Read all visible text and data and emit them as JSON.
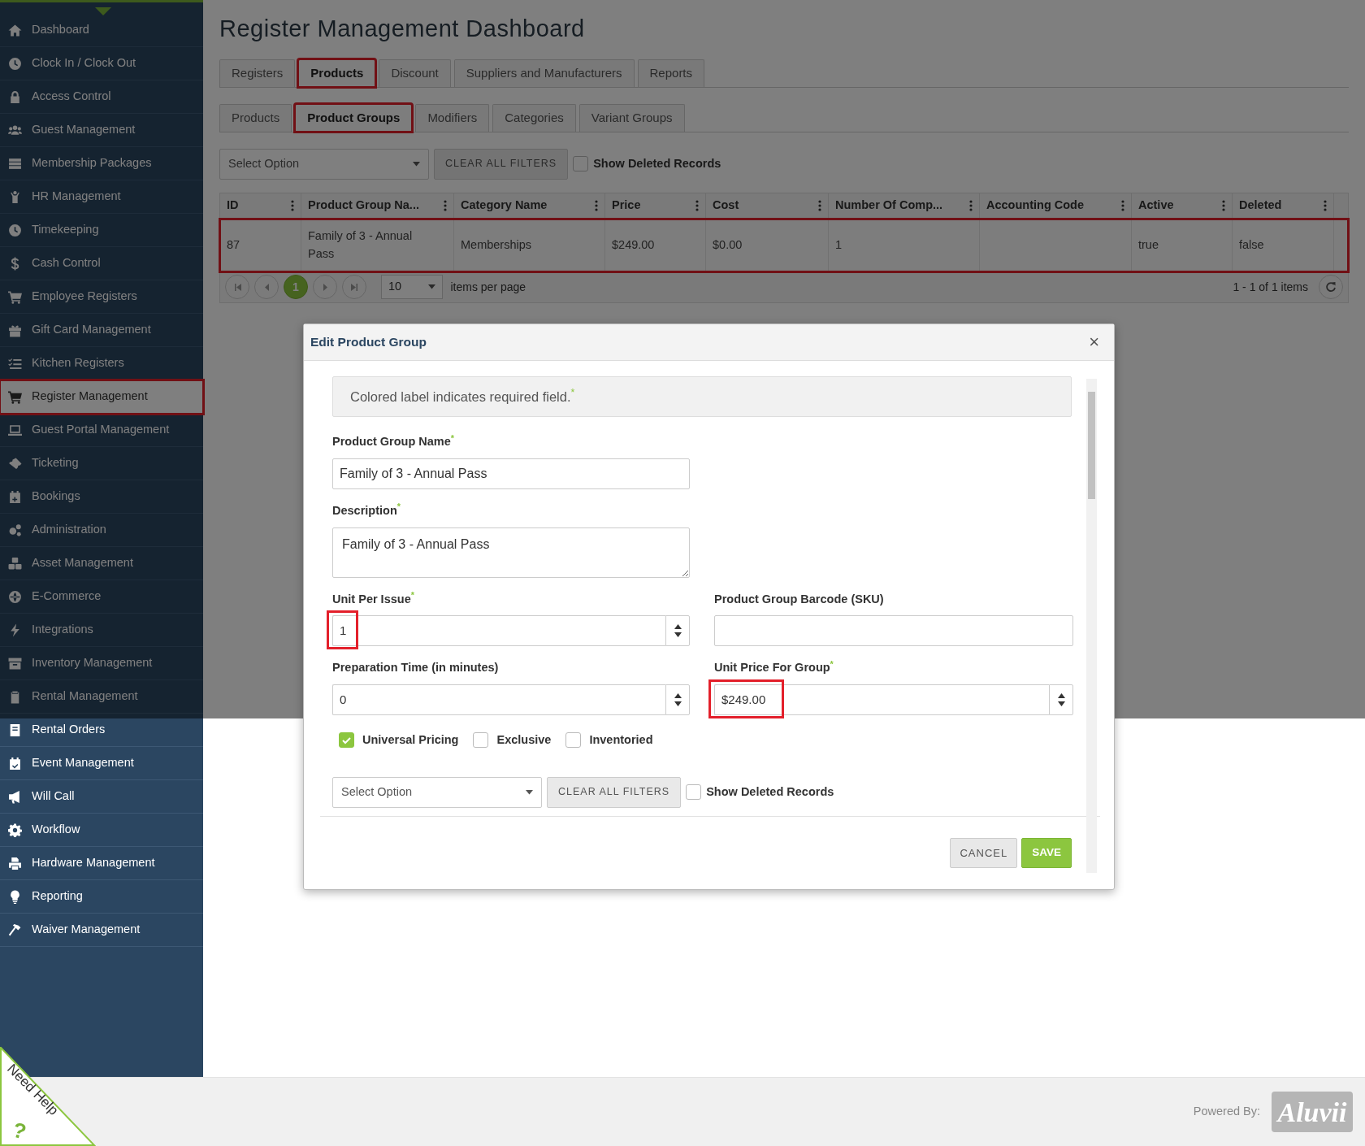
{
  "sidebar": {
    "items": [
      {
        "label": "Dashboard",
        "selected": false,
        "highlighted": false
      },
      {
        "label": "Clock In / Clock Out",
        "selected": false,
        "highlighted": false
      },
      {
        "label": "Access Control",
        "selected": false,
        "highlighted": false
      },
      {
        "label": "Guest Management",
        "selected": false,
        "highlighted": false
      },
      {
        "label": "Membership Packages",
        "selected": false,
        "highlighted": false
      },
      {
        "label": "HR Management",
        "selected": false,
        "highlighted": false
      },
      {
        "label": "Timekeeping",
        "selected": false,
        "highlighted": false
      },
      {
        "label": "Cash Control",
        "selected": false,
        "highlighted": false
      },
      {
        "label": "Employee Registers",
        "selected": false,
        "highlighted": false
      },
      {
        "label": "Gift Card Management",
        "selected": false,
        "highlighted": false
      },
      {
        "label": "Kitchen Registers",
        "selected": false,
        "highlighted": false
      },
      {
        "label": "Register Management",
        "selected": true,
        "highlighted": true
      },
      {
        "label": "Guest Portal Management",
        "selected": false,
        "highlighted": false
      },
      {
        "label": "Ticketing",
        "selected": false,
        "highlighted": false
      },
      {
        "label": "Bookings",
        "selected": false,
        "highlighted": false
      },
      {
        "label": "Administration",
        "selected": false,
        "highlighted": false
      },
      {
        "label": "Asset Management",
        "selected": false,
        "highlighted": false
      },
      {
        "label": "E-Commerce",
        "selected": false,
        "highlighted": false
      },
      {
        "label": "Integrations",
        "selected": false,
        "highlighted": false
      },
      {
        "label": "Inventory Management",
        "selected": false,
        "highlighted": false
      },
      {
        "label": "Rental Management",
        "selected": false,
        "highlighted": false
      },
      {
        "label": "Rental Orders",
        "selected": false,
        "highlighted": false
      },
      {
        "label": "Event Management",
        "selected": false,
        "highlighted": false
      },
      {
        "label": "Will Call",
        "selected": false,
        "highlighted": false
      },
      {
        "label": "Workflow",
        "selected": false,
        "highlighted": false
      },
      {
        "label": "Hardware Management",
        "selected": false,
        "highlighted": false
      },
      {
        "label": "Reporting",
        "selected": false,
        "highlighted": false
      },
      {
        "label": "Waiver Management",
        "selected": false,
        "highlighted": false
      }
    ]
  },
  "page": {
    "title": "Register Management Dashboard"
  },
  "tabs": [
    {
      "label": "Registers",
      "selected": false,
      "highlighted": false
    },
    {
      "label": "Products",
      "selected": true,
      "highlighted": true
    },
    {
      "label": "Discount",
      "selected": false,
      "highlighted": false
    },
    {
      "label": "Suppliers and Manufacturers",
      "selected": false,
      "highlighted": false
    },
    {
      "label": "Reports",
      "selected": false,
      "highlighted": false
    }
  ],
  "subtabs": [
    {
      "label": "Products",
      "selected": false,
      "highlighted": false
    },
    {
      "label": "Product Groups",
      "selected": true,
      "highlighted": true
    },
    {
      "label": "Modifiers",
      "selected": false,
      "highlighted": false
    },
    {
      "label": "Categories",
      "selected": false,
      "highlighted": false
    },
    {
      "label": "Variant Groups",
      "selected": false,
      "highlighted": false
    }
  ],
  "filters": {
    "select_value": "Select Option",
    "clear_button": "CLEAR ALL FILTERS",
    "show_deleted": {
      "label": "Show Deleted Records",
      "checked": false
    }
  },
  "grid": {
    "columns": [
      "ID",
      "Product Group Na...",
      "Category Name",
      "Price",
      "Cost",
      "Number Of Comp...",
      "Accounting Code",
      "Active",
      "Deleted"
    ],
    "rows": [
      {
        "highlighted": true,
        "cells": [
          "87",
          "Family of 3 - Annual Pass",
          "Memberships",
          "$249.00",
          "$0.00",
          "1",
          "",
          "true",
          "false"
        ]
      }
    ],
    "pager": {
      "pages": [
        {
          "label": "1",
          "selected": true
        }
      ],
      "page_size": "10",
      "page_size_label": "items per page",
      "summary": "1 - 1 of 1 items"
    }
  },
  "modal": {
    "title": "Edit Product Group",
    "close": "×",
    "notice": {
      "text": "Colored label indicates required field.",
      "mark": "*"
    },
    "rows": [
      [
        {
          "kind": "text",
          "label": "Product Group Name",
          "mark": "*",
          "value": "Family of 3 - Annual Pass"
        }
      ],
      [
        {
          "kind": "textarea",
          "label": "Description",
          "mark": "*",
          "value": "Family of 3 - Annual Pass"
        }
      ],
      [
        {
          "kind": "number",
          "label": "Unit Per Issue",
          "mark": "*",
          "value": "1",
          "highlighted": true
        },
        {
          "kind": "text",
          "label": "Product Group Barcode (SKU)"
        }
      ],
      [
        {
          "kind": "number",
          "label": "Preparation Time (in minutes)",
          "value": "0"
        },
        {
          "kind": "number",
          "label": "Unit Price For Group",
          "mark": "*",
          "value": "$249.00",
          "highlighted": true
        }
      ]
    ],
    "checkboxes": [
      {
        "label": "Universal Pricing",
        "checked": true
      },
      {
        "label": "Exclusive",
        "checked": false
      },
      {
        "label": "Inventoried",
        "checked": false
      }
    ],
    "filters": {
      "select_value": "Select Option",
      "clear_button": "CLEAR ALL FILTERS",
      "show_deleted": {
        "label": "Show Deleted Records",
        "checked": false
      }
    },
    "buttons": [
      {
        "label": "CANCEL",
        "kind": "secondary"
      },
      {
        "label": "SAVE",
        "kind": "primary"
      }
    ]
  },
  "help": {
    "label": "Need Help",
    "mark": "?"
  },
  "footer": {
    "powered_by": "Powered By:",
    "logo": "Aluvii"
  }
}
